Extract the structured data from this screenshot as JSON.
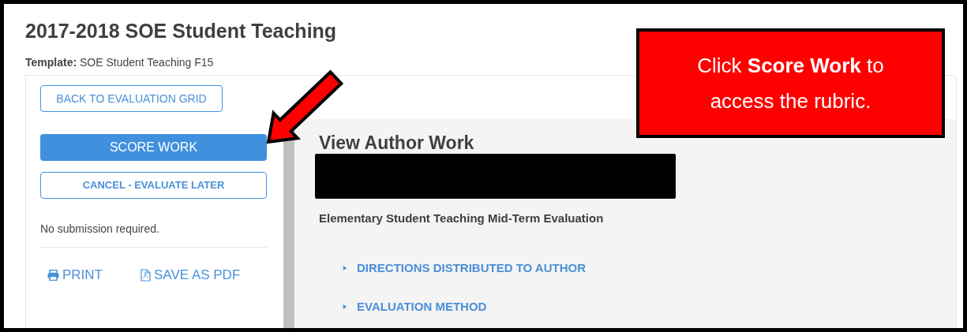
{
  "page": {
    "title": "2017-2018 SOE Student Teaching",
    "template": "**Template:** SOE Student Teaching F15"
  },
  "sidebar": {
    "back_button": "BACK TO EVALUATION GRID",
    "buttons": [
      {
        "label": "SCORE WORK",
        "kind": "primary"
      },
      {
        "label": "CANCEL - EVALUATE LATER",
        "kind": "outline"
      }
    ],
    "note": "No submission required.",
    "actions": [
      {
        "label": "PRINT",
        "kind": "print"
      },
      {
        "label": "SAVE AS PDF",
        "kind": "pdf"
      }
    ]
  },
  "main": {
    "heading": "View Author Work",
    "subtitle": "Elementary Student Teaching Mid-Term Evaluation",
    "sections": [
      {
        "label": "DIRECTIONS DISTRIBUTED TO AUTHOR",
        "expanded": false
      },
      {
        "label": "EVALUATION METHOD",
        "expanded": false
      }
    ]
  },
  "callout": {
    "text": "Click **Score Work** to access the rubric."
  }
}
